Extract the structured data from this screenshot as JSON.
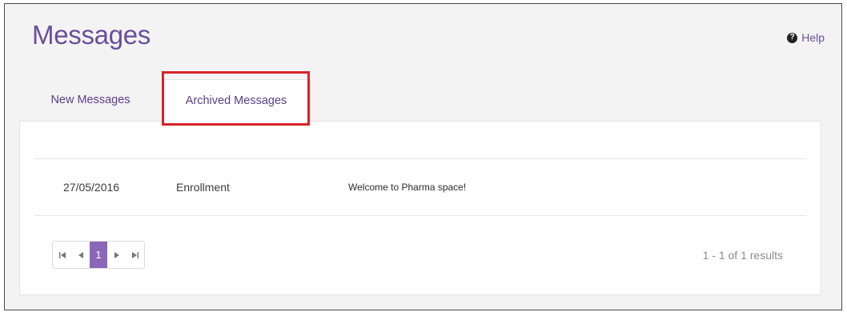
{
  "page": {
    "title": "Messages",
    "help_label": "Help",
    "help_icon_glyph": "?"
  },
  "tabs": [
    {
      "label": "New Messages",
      "active": false
    },
    {
      "label": "Archived Messages",
      "active": true
    }
  ],
  "messages": [
    {
      "date": "27/05/2016",
      "type": "Enrollment",
      "subject": "Welcome to Pharma space!"
    }
  ],
  "pagination": {
    "first_glyph": "⏮",
    "prev_glyph": "◀",
    "current_page": "1",
    "next_glyph": "▶",
    "last_glyph": "⏭",
    "results_text": "1 - 1 of 1 results"
  },
  "colors": {
    "accent": "#6a4e9c",
    "active_page": "#8a67b8",
    "highlight": "#d8232a"
  }
}
